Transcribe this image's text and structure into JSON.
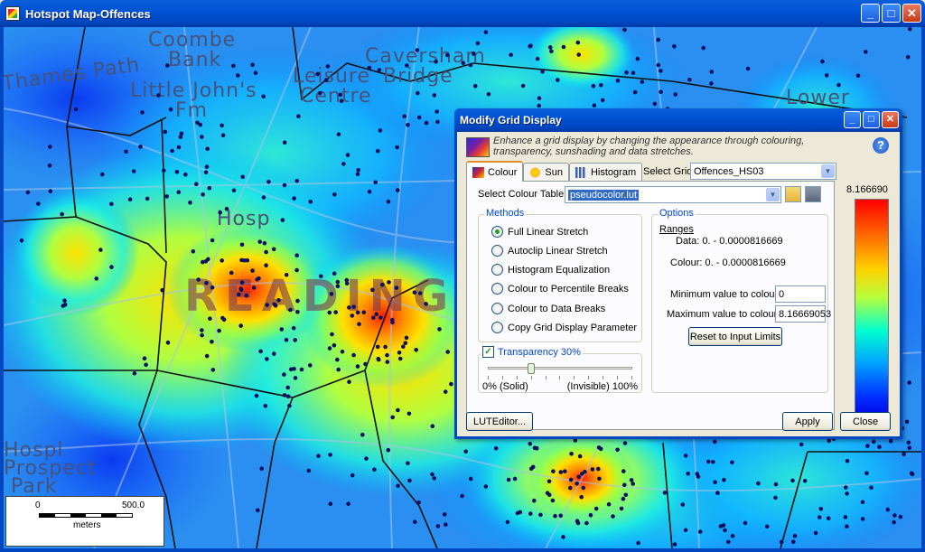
{
  "window": {
    "title": "Hotspot Map-Offences",
    "minimize_glyph": "_",
    "maximize_glyph": "□",
    "close_glyph": "✕"
  },
  "map": {
    "labels": [
      "Coombe",
      "Bank",
      "Little John's",
      "Fm",
      "Thames Path",
      "Leisure",
      "Centre",
      "Caversham",
      "Bridge",
      "Lower",
      "Hosp",
      "Prospect",
      "Park",
      "Hospl",
      "READING"
    ],
    "scale_bar": {
      "start": "0",
      "end": "500.0",
      "unit": "meters"
    }
  },
  "dialog": {
    "title": "Modify Grid Display",
    "description": "Enhance a grid display by changing the appearance through colouring, transparency, sunshading and data stretches.",
    "help_glyph": "?",
    "tabs": [
      {
        "label": "Colour",
        "icon": "colour-ramp-icon"
      },
      {
        "label": "Sun",
        "icon": "sun-icon"
      },
      {
        "label": "Histogram",
        "icon": "histogram-icon"
      }
    ],
    "select_grid_label": "Select Grid",
    "select_grid_value": "Offences_HS03",
    "colour_table_label": "Select Colour Table",
    "colour_table_value": "pseudocolor.lut",
    "methods": {
      "title": "Methods",
      "options": [
        "Full Linear Stretch",
        "Autoclip Linear Stretch",
        "Histogram Equalization",
        "Colour to Percentile Breaks",
        "Colour to Data Breaks",
        "Copy  Grid  Display Parameter"
      ],
      "selected_index": 0
    },
    "transparency": {
      "label": "Transparency 30%",
      "checked": true,
      "value_percent": 30,
      "min_label": "0% (Solid)",
      "max_label": "(Invisible) 100%"
    },
    "options": {
      "title": "Options",
      "ranges_label": "Ranges",
      "data_range": "Data: 0. - 0.0000816669",
      "colour_range": "Colour: 0. - 0.0000816669",
      "min_label": "Minimum value to colour",
      "min_value": "0",
      "max_label": "Maximum value to colour",
      "max_value": "8.16669053",
      "reset_button": "Reset to Input Limits"
    },
    "legend": {
      "max": "8.166690",
      "min": "0"
    },
    "buttons": {
      "lut_editor": "LUTEditor...",
      "apply": "Apply",
      "close": "Close"
    },
    "colors": {
      "accent": "#0046d5",
      "title_bar": "#0047c1"
    }
  }
}
